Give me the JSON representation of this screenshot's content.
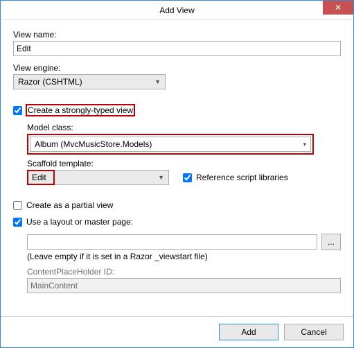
{
  "window": {
    "title": "Add View",
    "close_glyph": "✕"
  },
  "view_name": {
    "label": "View name:",
    "value": "Edit"
  },
  "view_engine": {
    "label": "View engine:",
    "selected": "Razor (CSHTML)"
  },
  "strongly_typed": {
    "checkbox_label": "Create a strongly-typed view",
    "checked": true,
    "model_class": {
      "label": "Model class:",
      "selected": "Album (MvcMusicStore.Models)"
    },
    "scaffold": {
      "label": "Scaffold template:",
      "selected": "Edit"
    },
    "reference_scripts": {
      "label": "Reference script libraries",
      "checked": true
    }
  },
  "partial_view": {
    "label": "Create as a partial view",
    "checked": false
  },
  "layout": {
    "checkbox_label": "Use a layout or master page:",
    "checked": true,
    "path_value": "",
    "browse_label": "...",
    "hint": "(Leave empty if it is set in a Razor _viewstart file)",
    "cph_label": "ContentPlaceHolder ID:",
    "cph_value": "MainContent"
  },
  "buttons": {
    "ok": "Add",
    "cancel": "Cancel"
  }
}
